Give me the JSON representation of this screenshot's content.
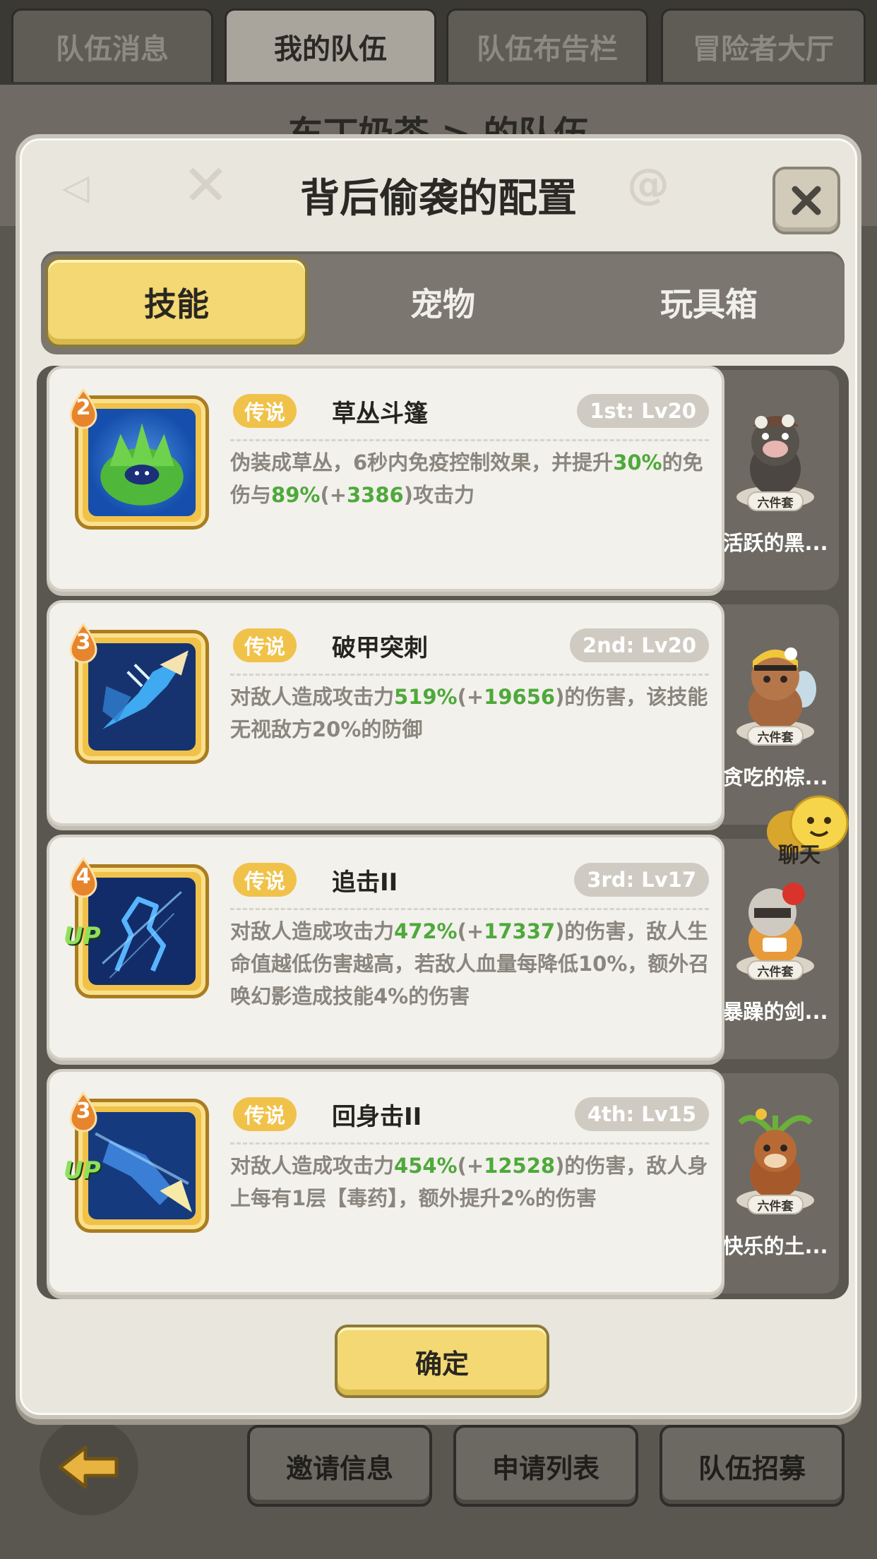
{
  "top_tabs": [
    "队伍消息",
    "我的队伍",
    "队伍布告栏",
    "冒险者大厅"
  ],
  "bg_title": "东丁奶茶 > 的队伍",
  "modal": {
    "title": "背后偷袭的配置",
    "tabs": [
      "技能",
      "宠物",
      "玩具箱"
    ],
    "active_tab": "技能",
    "confirm_label": "确定"
  },
  "skills": [
    {
      "level": "2",
      "rarity": "传说",
      "name": "草丛斗篷",
      "slot": "1st: Lv20",
      "has_up": false,
      "desc": [
        "伪装成草丛，6秒内免疫控制效果，并提升",
        "30%",
        "的免伤与",
        "89%",
        "(+",
        "3386",
        ")攻击力"
      ],
      "icon": "bush-cloak-icon"
    },
    {
      "level": "3",
      "rarity": "传说",
      "name": "破甲突刺",
      "slot": "2nd: Lv20",
      "has_up": false,
      "desc": [
        "对敌人造成攻击力",
        "519%",
        "(+",
        "19656",
        ")的伤害，该技能无视敌方20%的防御"
      ],
      "icon": "armor-pierce-icon"
    },
    {
      "level": "4",
      "rarity": "传说",
      "name": "追击II",
      "slot": "3rd: Lv17",
      "has_up": true,
      "desc": [
        "对敌人造成攻击力",
        "472%",
        "(+",
        "17337",
        ")的伤害，敌人生命值越低伤害越高，若敌人血量每降低10%，额外召唤幻影造成技能4%的伤害"
      ],
      "icon": "pursuit-icon"
    },
    {
      "level": "3",
      "rarity": "传说",
      "name": "回身击II",
      "slot": "4th: Lv15",
      "has_up": true,
      "desc": [
        "对敌人造成攻击力",
        "454%",
        "(+",
        "12528",
        ")的伤害，敌人身上每有1层【毒药】，额外提升2%的伤害"
      ],
      "icon": "back-strike-icon"
    }
  ],
  "up_label": "UP",
  "pets": [
    {
      "name": "活跃的黑...",
      "badge": "六件套",
      "icon": "boar-pet-icon"
    },
    {
      "name": "贪吃的棕...",
      "badge": "六件套",
      "icon": "bee-bear-pet-icon"
    },
    {
      "name": "暴躁的剑...",
      "badge": "六件套",
      "icon": "raccoon-pet-icon"
    },
    {
      "name": "快乐的土...",
      "badge": "六件套",
      "icon": "mole-pet-icon"
    }
  ],
  "chat_label": "聊天",
  "bottom_buttons": [
    "邀请信息",
    "申请列表",
    "队伍招募"
  ],
  "colors": {
    "accent_yellow": "#f3d873",
    "number_green": "#4ea93b",
    "rarity_gold": "#f0c24a"
  }
}
